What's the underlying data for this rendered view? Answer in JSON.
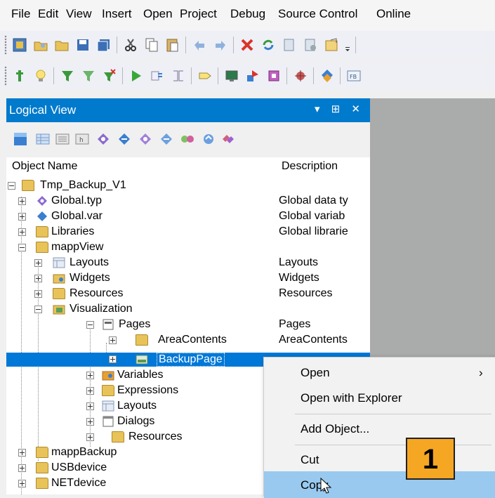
{
  "menubar": {
    "items": [
      "File",
      "Edit",
      "View",
      "Insert",
      "Open",
      "Project",
      "Debug",
      "Source Control",
      "Online"
    ]
  },
  "toolbar1": {
    "icons": [
      "new-project-icon",
      "open-icon",
      "open-folder-icon",
      "save-icon",
      "save-all-icon",
      "cut-icon",
      "copy-icon",
      "paste-icon",
      "undo-icon",
      "redo-icon",
      "delete-icon",
      "refresh-icon",
      "document-icon",
      "document-settings-icon",
      "properties-icon"
    ]
  },
  "toolbar2": {
    "icons": [
      "build-icon",
      "lightbulb-icon",
      "filter-icon",
      "filter-remove-icon",
      "filter-add-icon",
      "run-icon",
      "step-icon",
      "watch-icon",
      "breakpoint-icon",
      "monitor-icon",
      "transfer-icon",
      "config-icon",
      "bug-icon",
      "deploy-icon",
      "fb-icon"
    ]
  },
  "panel": {
    "title": "Logical View",
    "controls": "▾ ⊞ ✕",
    "columns": {
      "name": "Object Name",
      "description": "Description"
    },
    "rows": [
      {
        "label": "Tmp_Backup_V1",
        "desc": ""
      },
      {
        "label": "Global.typ",
        "desc": "Global data ty"
      },
      {
        "label": "Global.var",
        "desc": "Global variab"
      },
      {
        "label": "Libraries",
        "desc": "Global librarie"
      },
      {
        "label": "mappView",
        "desc": ""
      },
      {
        "label": "Layouts",
        "desc": "Layouts"
      },
      {
        "label": "Widgets",
        "desc": "Widgets"
      },
      {
        "label": "Resources",
        "desc": "Resources"
      },
      {
        "label": "Visualization",
        "desc": ""
      },
      {
        "label": "Pages",
        "desc": "Pages"
      },
      {
        "label": "AreaContents",
        "desc": "AreaContents"
      },
      {
        "label": "BackupPage",
        "desc": ""
      },
      {
        "label": "Variables",
        "desc": ""
      },
      {
        "label": "Expressions",
        "desc": ""
      },
      {
        "label": "Layouts",
        "desc": ""
      },
      {
        "label": "Dialogs",
        "desc": ""
      },
      {
        "label": "Resources",
        "desc": ""
      },
      {
        "label": "mappBackup",
        "desc": ""
      },
      {
        "label": "USBdevice",
        "desc": ""
      },
      {
        "label": "NETdevice",
        "desc": ""
      }
    ]
  },
  "context_menu": {
    "open": "Open",
    "open_arrow": "›",
    "open_with_explorer": "Open with Explorer",
    "add_object": "Add Object...",
    "cut": "Cut",
    "copy": "Copy"
  },
  "step_badge": "1",
  "colors": {
    "accent": "#007acc",
    "selection": "#0078d7",
    "badge": "#f5a623"
  }
}
